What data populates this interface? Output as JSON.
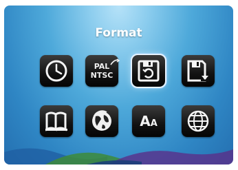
{
  "menu": {
    "title": "Format",
    "pal_label": "PAL",
    "ntsc_label": "NTSC",
    "font_label_big": "A",
    "font_label_small": "A",
    "selected_item": "format-icon",
    "items": [
      {
        "icon": "clock-icon"
      },
      {
        "icon": "pal-ntsc-icon"
      },
      {
        "icon": "format-icon"
      },
      {
        "icon": "save-download-icon"
      },
      {
        "icon": "book-icon"
      },
      {
        "icon": "globe-cycle-icon"
      },
      {
        "icon": "font-size-icon"
      },
      {
        "icon": "language-globe-icon"
      }
    ]
  },
  "colors": {
    "background_top": "#b6e2f8",
    "background_bottom": "#246fb0",
    "tile": "#121212",
    "selection_outline": "#e6f3ff"
  }
}
